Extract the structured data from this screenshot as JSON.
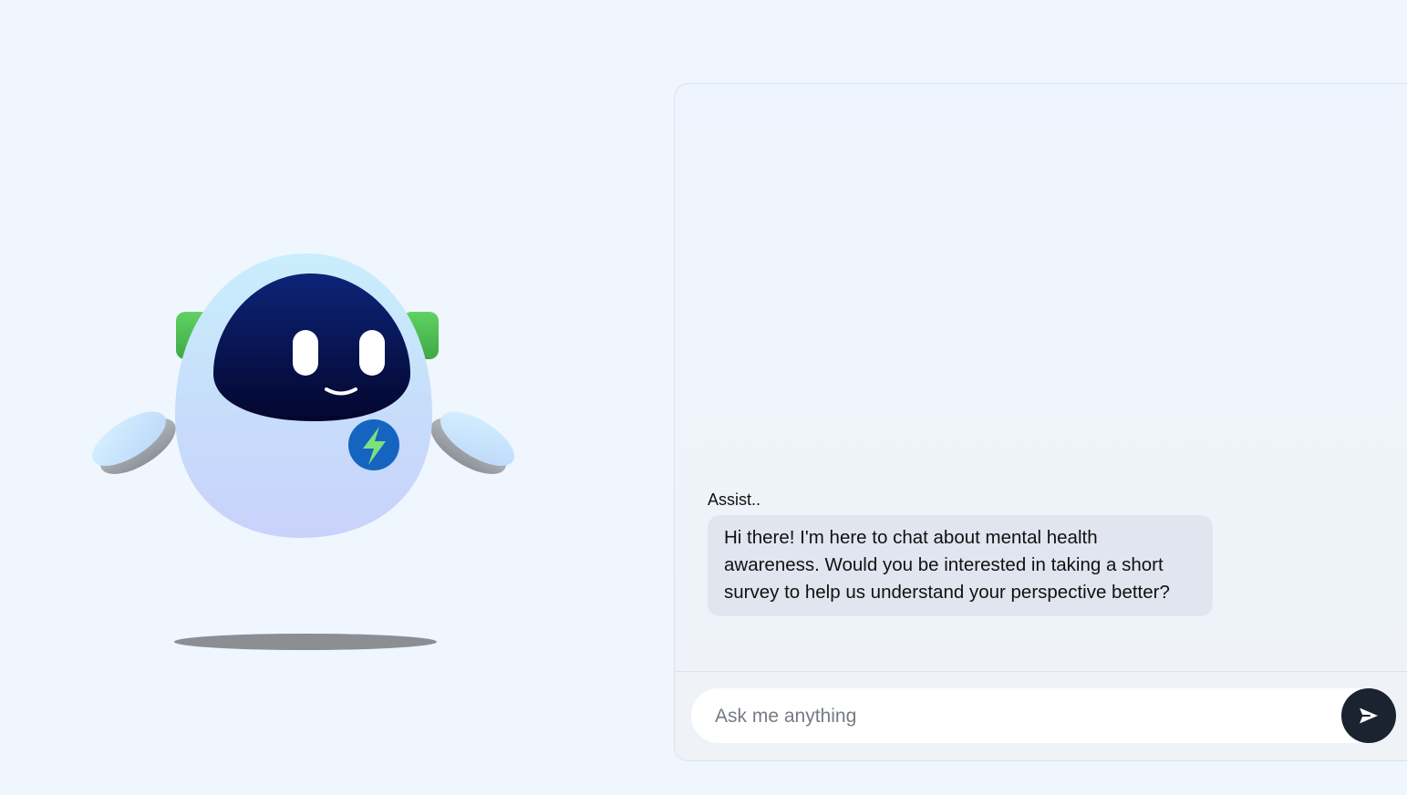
{
  "mascot": {
    "icon": "robot-mascot-icon",
    "badge_icon": "lightning-bolt-icon"
  },
  "chat": {
    "messages": [
      {
        "sender": "Assist..",
        "text": "Hi there! I'm here to chat about mental health awareness. Would you be interested in taking a short survey to help us understand your perspective better?"
      }
    ],
    "input": {
      "placeholder": "Ask me anything",
      "value": ""
    },
    "send_icon": "send-arrow-icon"
  },
  "colors": {
    "page_background": "#eff6fe",
    "bubble_background": "#e1e5ef",
    "send_button": "#1b2230",
    "robot_visor": "#0b1a5e",
    "robot_ears": "#4cbf52",
    "robot_badge": "#1565c0",
    "robot_bolt": "#7ee07a"
  }
}
